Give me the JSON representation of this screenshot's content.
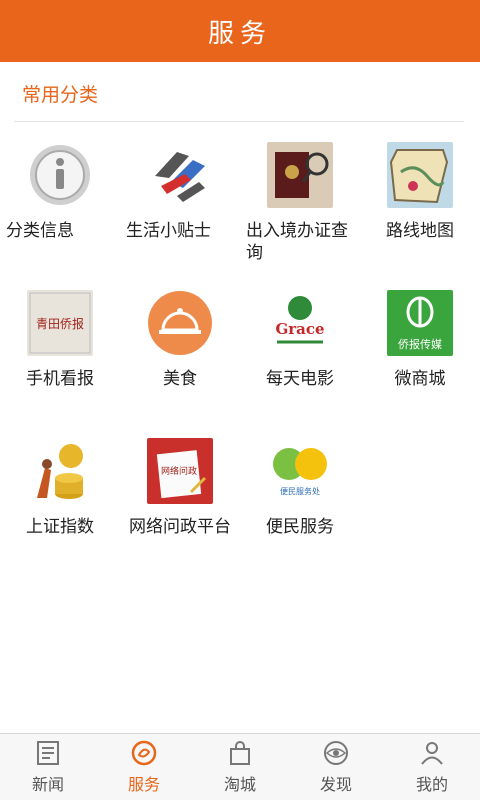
{
  "header": {
    "title": "服务"
  },
  "section": {
    "title": "常用分类"
  },
  "items": [
    {
      "label": "分类信息",
      "icon": "info-icon"
    },
    {
      "label": "生活小贴士",
      "icon": "life-tips-icon"
    },
    {
      "label": "出入境办证查询",
      "icon": "passport-icon"
    },
    {
      "label": "路线地图",
      "icon": "map-icon"
    },
    {
      "label": "手机看报",
      "icon": "newspaper-icon"
    },
    {
      "label": "美食",
      "icon": "food-cloche-icon"
    },
    {
      "label": "每天电影",
      "icon": "movie-icon"
    },
    {
      "label": "微商城",
      "icon": "micro-mall-icon"
    },
    {
      "label": "上证指数",
      "icon": "stock-index-icon"
    },
    {
      "label": "网络问政平台",
      "icon": "online-politics-icon"
    },
    {
      "label": "便民服务",
      "icon": "convenience-service-icon"
    }
  ],
  "icon_text": {
    "newspaper": "青田侨报",
    "movie": "Grace",
    "mall": "侨报传媒",
    "politics": "网络问政",
    "convenience": "便民服务处"
  },
  "tabs": [
    {
      "label": "新闻",
      "icon": "news-icon"
    },
    {
      "label": "服务",
      "icon": "service-icon",
      "active": true
    },
    {
      "label": "淘城",
      "icon": "shopping-bag-icon"
    },
    {
      "label": "发现",
      "icon": "discover-icon"
    },
    {
      "label": "我的",
      "icon": "user-icon"
    }
  ],
  "colors": {
    "accent": "#e8651b"
  }
}
